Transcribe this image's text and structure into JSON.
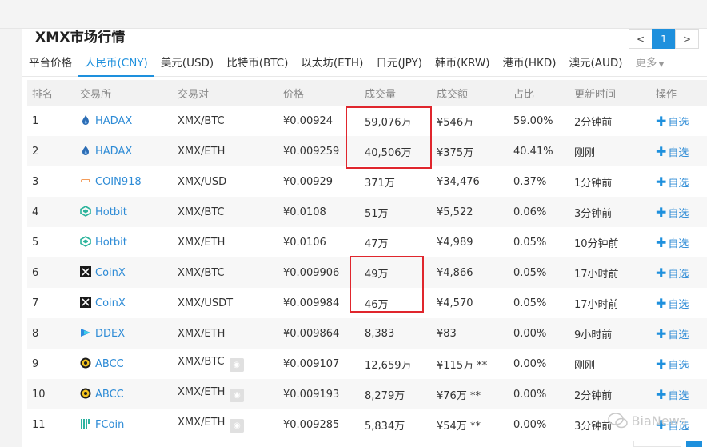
{
  "panel": {
    "title": "XMX市场行情"
  },
  "pager": {
    "prev": "<",
    "page": "1",
    "next": ">"
  },
  "tabs": [
    {
      "label": "平台价格",
      "active": false
    },
    {
      "label": "人民币(CNY)",
      "active": true
    },
    {
      "label": "美元(USD)",
      "active": false
    },
    {
      "label": "比特币(BTC)",
      "active": false
    },
    {
      "label": "以太坊(ETH)",
      "active": false
    },
    {
      "label": "日元(JPY)",
      "active": false
    },
    {
      "label": "韩币(KRW)",
      "active": false
    },
    {
      "label": "港币(HKD)",
      "active": false
    },
    {
      "label": "澳元(AUD)",
      "active": false
    }
  ],
  "more_label": "更多",
  "headers": [
    "排名",
    "交易所",
    "交易对",
    "价格",
    "成交量",
    "成交额",
    "占比",
    "更新时间",
    "操作"
  ],
  "rows": [
    {
      "rank": "1",
      "exchange": "HADAX",
      "logo": "hadax",
      "pair": "XMX/BTC",
      "price": "¥0.00924",
      "volume": "59,076万",
      "amount": "¥546万",
      "share": "59.00%",
      "updated": "2分钟前",
      "action": "自选"
    },
    {
      "rank": "2",
      "exchange": "HADAX",
      "logo": "hadax",
      "pair": "XMX/ETH",
      "price": "¥0.009259",
      "volume": "40,506万",
      "amount": "¥375万",
      "share": "40.41%",
      "updated": "刚刚",
      "action": "自选"
    },
    {
      "rank": "3",
      "exchange": "COIN918",
      "logo": "coin918",
      "pair": "XMX/USD",
      "price": "¥0.00929",
      "volume": "371万",
      "amount": "¥34,476",
      "share": "0.37%",
      "updated": "1分钟前",
      "action": "自选"
    },
    {
      "rank": "4",
      "exchange": "Hotbit",
      "logo": "hotbit",
      "pair": "XMX/BTC",
      "price": "¥0.0108",
      "volume": "51万",
      "amount": "¥5,522",
      "share": "0.06%",
      "updated": "3分钟前",
      "action": "自选"
    },
    {
      "rank": "5",
      "exchange": "Hotbit",
      "logo": "hotbit",
      "pair": "XMX/ETH",
      "price": "¥0.0106",
      "volume": "47万",
      "amount": "¥4,989",
      "share": "0.05%",
      "updated": "10分钟前",
      "action": "自选"
    },
    {
      "rank": "6",
      "exchange": "CoinX",
      "logo": "coinx",
      "pair": "XMX/BTC",
      "price": "¥0.009906",
      "volume": "49万",
      "amount": "¥4,866",
      "share": "0.05%",
      "updated": "17小时前",
      "action": "自选"
    },
    {
      "rank": "7",
      "exchange": "CoinX",
      "logo": "coinx",
      "pair": "XMX/USDT",
      "price": "¥0.009984",
      "volume": "46万",
      "amount": "¥4,570",
      "share": "0.05%",
      "updated": "17小时前",
      "action": "自选"
    },
    {
      "rank": "8",
      "exchange": "DDEX",
      "logo": "ddex",
      "pair": "XMX/ETH",
      "price": "¥0.009864",
      "volume": "8,383",
      "amount": "¥83",
      "share": "0.00%",
      "updated": "9小时前",
      "action": "自选"
    },
    {
      "rank": "9",
      "exchange": "ABCC",
      "logo": "abcc",
      "pair": "XMX/BTC",
      "pair_icon": true,
      "price": "¥0.009107",
      "volume": "12,659万",
      "amount": "¥115万 **",
      "share": "0.00%",
      "updated": "刚刚",
      "action": "自选"
    },
    {
      "rank": "10",
      "exchange": "ABCC",
      "logo": "abcc",
      "pair": "XMX/ETH",
      "pair_icon": true,
      "price": "¥0.009193",
      "volume": "8,279万",
      "amount": "¥76万 **",
      "share": "0.00%",
      "updated": "2分钟前",
      "action": "自选"
    },
    {
      "rank": "11",
      "exchange": "FCoin",
      "logo": "fcoin",
      "pair": "XMX/ETH",
      "pair_icon": true,
      "price": "¥0.009285",
      "volume": "5,834万",
      "amount": "¥54万 **",
      "share": "0.00%",
      "updated": "3分钟前",
      "action": "自选"
    }
  ],
  "watermark": "BiaNews",
  "colors": {
    "accent": "#1e90dd",
    "highlight": "#e0262d"
  }
}
